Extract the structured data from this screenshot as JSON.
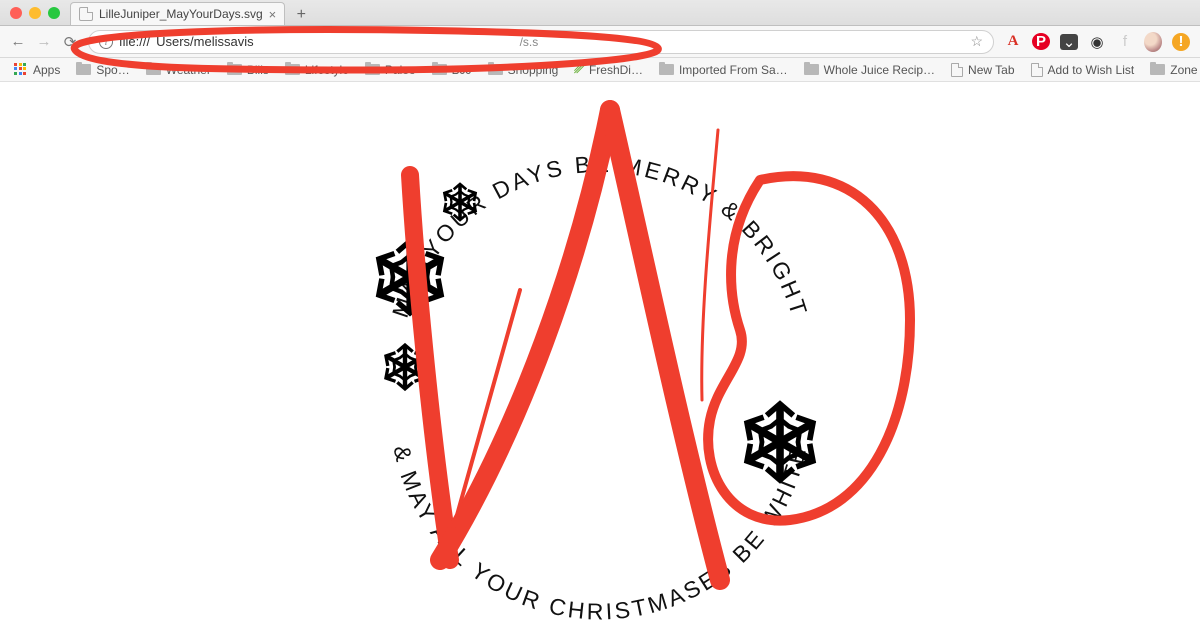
{
  "window": {
    "tab_title": "LilleJuniper_MayYourDays.svg",
    "close_glyph": "×",
    "newtab_glyph": "+"
  },
  "toolbar": {
    "back_glyph": "←",
    "fwd_glyph": "→",
    "reload_glyph": "⟳",
    "info_glyph": "i",
    "url_scheme": "file:///",
    "url_path": "Users/melissavis",
    "url_truncated_hint": "/s.s",
    "star_glyph": "☆",
    "icons": {
      "A": "A",
      "pinterest": "P",
      "pocket": "⌄",
      "camera": "◉",
      "facebook": "f",
      "alert": "!"
    }
  },
  "bookmarks": {
    "apps_label": "Apps",
    "items": [
      {
        "type": "folder",
        "label": "Spo…"
      },
      {
        "type": "folder",
        "label": "Weather"
      },
      {
        "type": "folder",
        "label": "Bills"
      },
      {
        "type": "folder",
        "label": "Lifestyle"
      },
      {
        "type": "folder",
        "label": "Paleo"
      },
      {
        "type": "folder",
        "label": "BJJ"
      },
      {
        "type": "folder",
        "label": "Shopping"
      },
      {
        "type": "site",
        "label": "FreshDi…"
      },
      {
        "type": "folder",
        "label": "Imported From Sa…"
      },
      {
        "type": "folder",
        "label": "Whole Juice Recip…"
      },
      {
        "type": "page",
        "label": "New Tab"
      },
      {
        "type": "page",
        "label": "Add to Wish List"
      },
      {
        "type": "folder",
        "label": "Zone"
      }
    ],
    "overflow_glyph": "»"
  },
  "svg_content": {
    "top_arc_text": "MAY YOUR DAYS BE MERRY & BRIGHT",
    "bottom_arc_text": "& MAY ALL YOUR CHRISTMASES BE WHITE"
  },
  "annotation": {
    "color": "#ef3e2e",
    "meaning_top": "circled address bar",
    "meaning_right": "circled right snowflake region",
    "meaning_center": "large NO strokes across SVG"
  }
}
